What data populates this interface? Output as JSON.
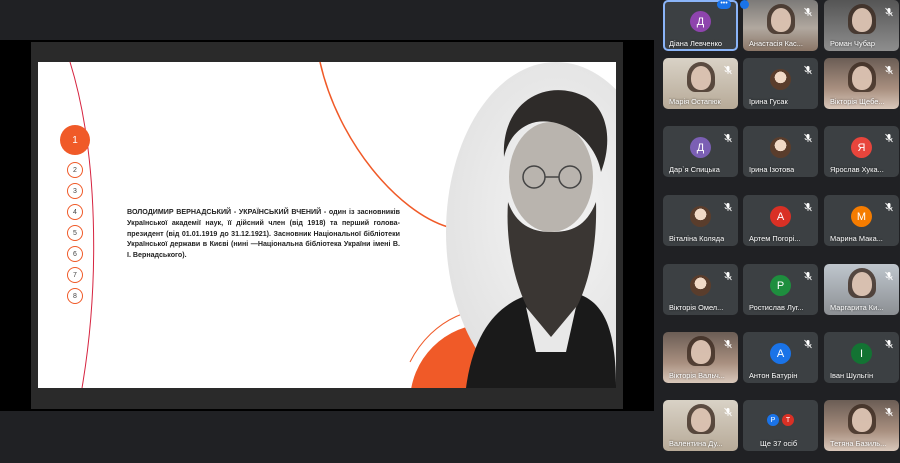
{
  "slide": {
    "nav": [
      "1",
      "2",
      "3",
      "4",
      "5",
      "6",
      "7",
      "8"
    ],
    "text": "ВОЛОДИМИР ВЕРНАДСЬКИЙ - УКРАЇНСЬКИЙ ВЧЕНИЙ - один із засновників Української академії наук, її дійсний член (від 1918) та перший голова-президент (від 01.01.1919 до 31.12.1921). Засновник Національної бібліотеки Української держави в Києві (нині —Національна бібліотека України імені В. І. Вернадського).",
    "accent_color": "#f05a28"
  },
  "participants": [
    {
      "name": "Діана Левченко",
      "initial": "Д",
      "color": "#8e44ad",
      "type": "avatar"
    },
    {
      "name": "Анастасія Кас...",
      "type": "photo"
    },
    {
      "name": "Роман Чубар",
      "type": "photo"
    },
    {
      "name": "Марія Остапюк",
      "type": "photo"
    },
    {
      "name": "Ірина Гусак",
      "type": "photo-avatar"
    },
    {
      "name": "Вікторія Щебе...",
      "type": "photo"
    },
    {
      "name": "Дар`я Спицька",
      "initial": "Д",
      "color": "#7b5fb4",
      "type": "avatar"
    },
    {
      "name": "Ірина Ізотова",
      "type": "photo-avatar"
    },
    {
      "name": "Ярослав Хука...",
      "initial": "Я",
      "color": "#e8453c",
      "type": "avatar"
    },
    {
      "name": "Віталіна Коляда",
      "type": "photo-avatar"
    },
    {
      "name": "Артем Погорі...",
      "initial": "А",
      "color": "#d93025",
      "type": "avatar"
    },
    {
      "name": "Марина Мака...",
      "initial": "М",
      "color": "#f57c00",
      "type": "avatar"
    },
    {
      "name": "Вікторія Омел...",
      "type": "photo-avatar"
    },
    {
      "name": "Ростислав Луг...",
      "initial": "Р",
      "color": "#1e8e3e",
      "type": "avatar"
    },
    {
      "name": "Маргарита Ки...",
      "type": "photo"
    },
    {
      "name": "Вікторія Вальч...",
      "type": "photo"
    },
    {
      "name": "Антон Батурін",
      "initial": "А",
      "color": "#1a73e8",
      "type": "avatar"
    },
    {
      "name": "Іван Шульгін",
      "initial": "І",
      "color": "#137333",
      "type": "avatar"
    },
    {
      "name": "Валентина Ду...",
      "type": "photo"
    },
    {
      "name": "Ще 37 осіб",
      "type": "more",
      "initials": [
        "Р",
        "Т"
      ]
    },
    {
      "name": "Тетяна Базиль...",
      "type": "photo"
    }
  ]
}
